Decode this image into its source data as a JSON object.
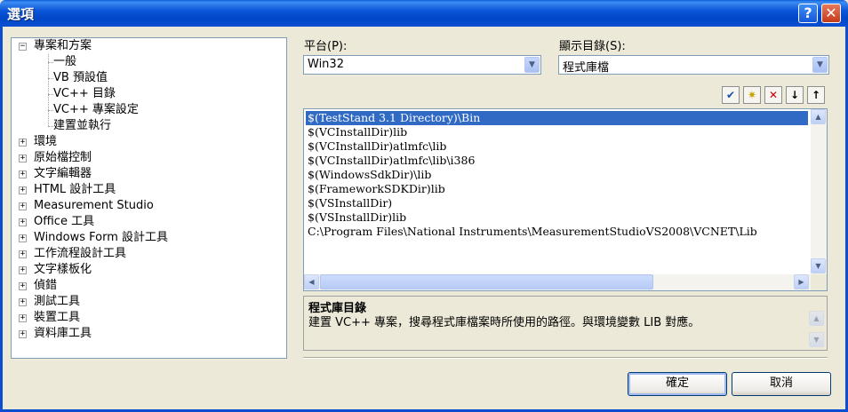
{
  "window": {
    "title": "選項",
    "help_glyph": "?",
    "close_glyph": "✕"
  },
  "tree": {
    "items": [
      {
        "label": "專案和方案",
        "expanded": true
      },
      {
        "label": "一般"
      },
      {
        "label": "VB 預設值"
      },
      {
        "label": "VC++ 目錄"
      },
      {
        "label": "VC++ 專案設定"
      },
      {
        "label": "建置並執行"
      },
      {
        "label": "環境"
      },
      {
        "label": "原始檔控制"
      },
      {
        "label": "文字編輯器"
      },
      {
        "label": "HTML 設計工具"
      },
      {
        "label": "Measurement Studio"
      },
      {
        "label": "Office 工具"
      },
      {
        "label": "Windows Form 設計工具"
      },
      {
        "label": "工作流程設計工具"
      },
      {
        "label": "文字樣板化"
      },
      {
        "label": "偵錯"
      },
      {
        "label": "測試工具"
      },
      {
        "label": "裝置工具"
      },
      {
        "label": "資料庫工具"
      }
    ],
    "expand_glyph": "+",
    "collapse_glyph": "−"
  },
  "platform": {
    "label": "平台(P):",
    "value": "Win32"
  },
  "show_dirs": {
    "label": "顯示目錄(S):",
    "value": "程式庫檔"
  },
  "toolbar": {
    "check_glyph": "✔",
    "new_folder_glyph": "✷",
    "delete_glyph": "✕",
    "down_glyph": "↓",
    "up_glyph": "↑"
  },
  "directories": [
    "$(TestStand 3.1 Directory)\\Bin",
    "$(VCInstallDir)lib",
    "$(VCInstallDir)atlmfc\\lib",
    "$(VCInstallDir)atlmfc\\lib\\i386",
    "$(WindowsSdkDir)\\lib",
    "$(FrameworkSDKDir)lib",
    "$(VSInstallDir)",
    "$(VSInstallDir)lib",
    "C:\\Program Files\\National Instruments\\MeasurementStudioVS2008\\VCNET\\Lib"
  ],
  "description": {
    "title": "程式庫目錄",
    "text": "建置 VC++ 專案，搜尋程式庫檔案時所使用的路徑。與環境變數 LIB 對應。"
  },
  "buttons": {
    "ok": "確定",
    "cancel": "取消"
  },
  "colors": {
    "titlebar": "#0b56d8",
    "selection": "#316ac5",
    "delete_icon": "#d00000"
  }
}
